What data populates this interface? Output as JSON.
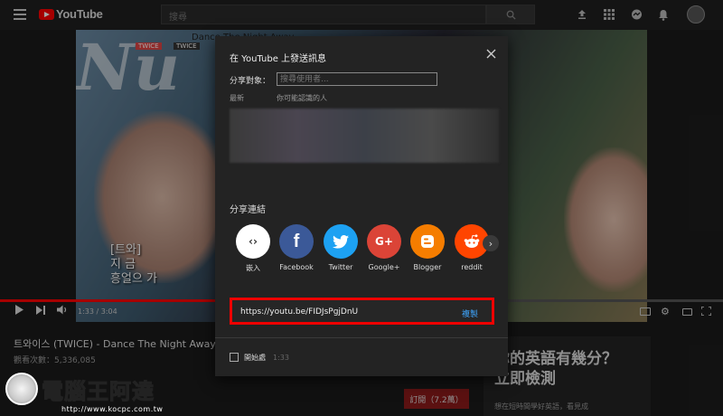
{
  "header": {
    "logo_text": "YouTube",
    "search_placeholder": "搜尋"
  },
  "video": {
    "overlay_title": "Dance The Night Away",
    "overlay_tag_1": "TWICE",
    "overlay_tag_2": "TWICE",
    "subtitle_lines": [
      "[트와]",
      "지 금",
      "흥얼으 가"
    ],
    "time": "1:33 / 3:04",
    "progress_fraction": 0.42,
    "title": "트와이스 (TWICE) - Dance The Night Away 교차",
    "views": "觀看次數：5,336,085",
    "subscribe_label": "訂閱（7.2萬）"
  },
  "ad": {
    "title_line1": "你的英語有幾分？",
    "title_line2": "立即檢測",
    "subtitle": "想在短時間學好英語，看見成"
  },
  "watermark": {
    "name": "電腦王阿達",
    "url": "http://www.kocpc.com.tw"
  },
  "dialog": {
    "title": "在 YouTube 上發送訊息",
    "to_label": "分享對象：",
    "to_placeholder": "搜尋使用者...",
    "recent_label": "最新",
    "suggest_label": "你可能認識的人",
    "share_link_label": "分享連結",
    "share_targets": [
      {
        "label": "嵌入",
        "icon": "embed-icon",
        "color": "#ffffff"
      },
      {
        "label": "Facebook",
        "icon": "facebook-icon",
        "color": "#3b5998"
      },
      {
        "label": "Twitter",
        "icon": "twitter-icon",
        "color": "#1da1f2"
      },
      {
        "label": "Google+",
        "icon": "google-plus-icon",
        "color": "#db4437"
      },
      {
        "label": "Blogger",
        "icon": "blogger-icon",
        "color": "#f57d00"
      },
      {
        "label": "reddit",
        "icon": "reddit-icon",
        "color": "#ff4500"
      }
    ],
    "link_url": "https://youtu.be/FIDJsPgjDnU",
    "copy_label": "複製",
    "start_label": "開始處",
    "start_time": "1:33"
  },
  "colors": {
    "highlight_border": "#ee0000",
    "copy_link": "#3ea6ff",
    "youtube_red": "#ff0000"
  }
}
